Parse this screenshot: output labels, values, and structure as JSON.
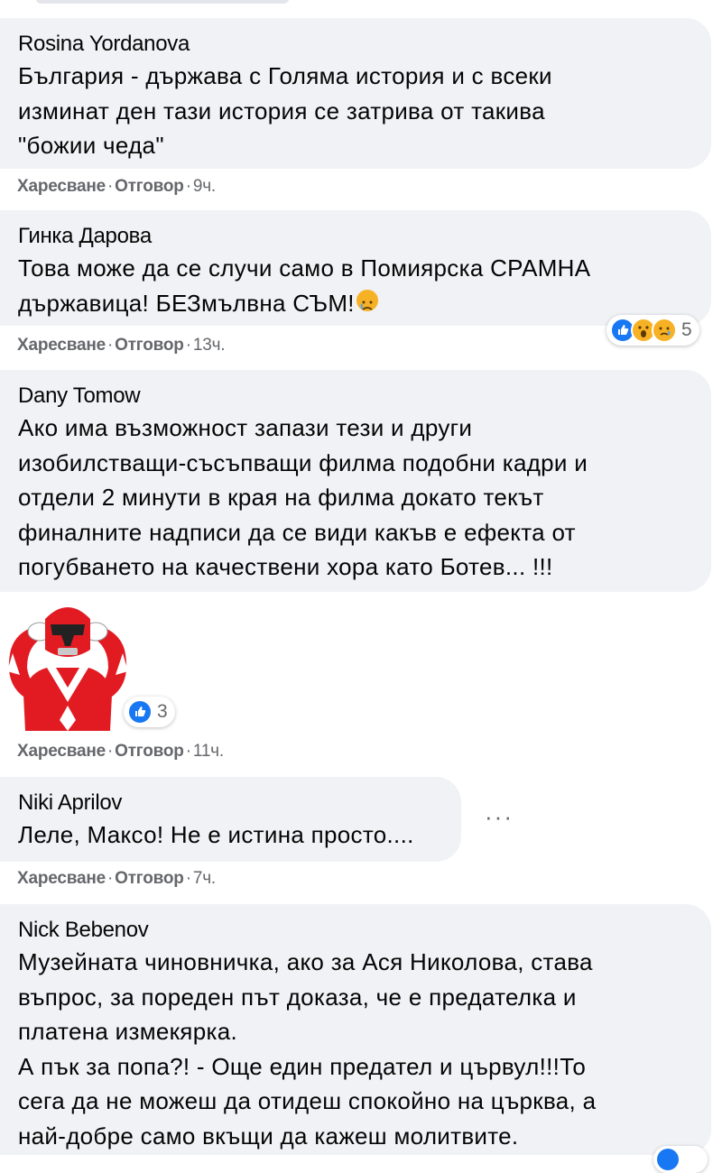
{
  "actions": {
    "like": "Харесване",
    "reply": "Отговор",
    "sep": "·"
  },
  "comments": [
    {
      "author": "Rosina Yordanova",
      "text": "България - държава с Голяма история и с всеки\nизминат ден тази история се затрива от такива\n\"божии чеда\"",
      "time": "9ч."
    },
    {
      "author": "Гинка Дарова",
      "text": "Това може да се случи само в Помиярска СРАМНА\nдържавица! БЕЗмълвна СЪМ!",
      "time": "13ч.",
      "reaction_count": "5",
      "reactions": [
        "like-icon",
        "wow-icon",
        "sad-icon"
      ]
    },
    {
      "author": "Dany Tomow",
      "text": "Ако има възможност запази тези и други\nизобилстващи-съсъпващи филма подобни кадри и\nотдели 2 минути в края на филма докато текът\nфиналните надписи да се види какъв е ефекта от\nпогубването на качествени хора като Ботев... !!!",
      "time": "11ч.",
      "sticker": "power-ranger-facepalm-sticker",
      "reaction_count": "3",
      "reactions": [
        "like-icon"
      ]
    },
    {
      "author": "Niki Aprilov",
      "text": "Леле, Максо! Не е истина просто....",
      "time": "7ч.",
      "more": "···"
    },
    {
      "author": "Nick Bebenov",
      "text": "Музейната чиновничка, ако за Ася Николова, става\nвъпрос, за пореден път доказа, че е предателка и\nплатена измекярка.\nА пък за попа?! - Още един предател и цървул!!!То\nсега да не можеш да отидеш спокойно на църква, а\nнай-добре само вкъщи да кажеш молитвите."
    }
  ],
  "colors": {
    "bubble": "#f0f2f5",
    "meta": "#65676b",
    "like": "#1877f2",
    "emoji": "#f7b125"
  }
}
